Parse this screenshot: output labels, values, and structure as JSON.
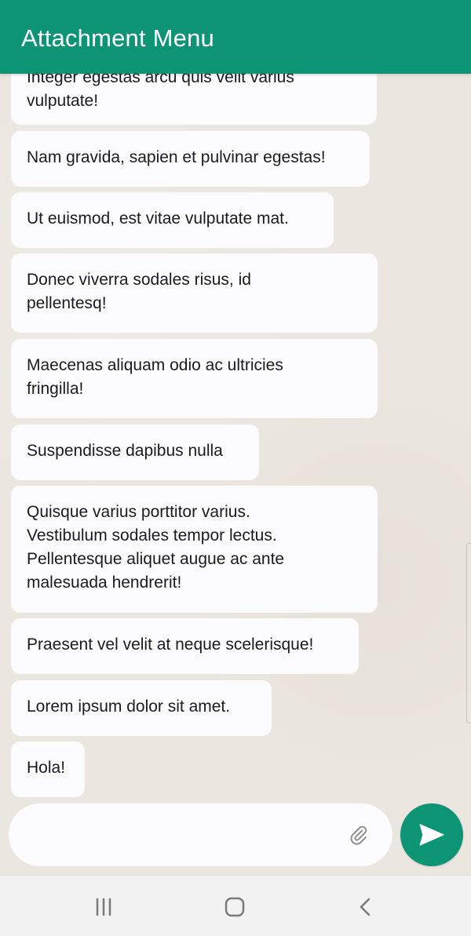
{
  "app": {
    "title": "Attachment Menu"
  },
  "messages": [
    {
      "text": "Integer egestas arcu quis velit varius\nvulputate!"
    },
    {
      "text": "Nam gravida, sapien et pulvinar egestas!"
    },
    {
      "text": "Ut euismod, est vitae vulputate mat."
    },
    {
      "text": "Donec viverra sodales risus, id\npellentesq!"
    },
    {
      "text": "Maecenas aliquam odio ac ultricies\nfringilla!"
    },
    {
      "text": "Suspendisse dapibus nulla"
    },
    {
      "text": "Quisque varius porttitor varius.\nVestibulum sodales tempor lectus.\nPellentesque aliquet augue ac ante\nmalesuada hendrerit!"
    },
    {
      "text": "Praesent vel velit at neque scelerisque!"
    },
    {
      "text": "Lorem ipsum dolor sit amet."
    },
    {
      "text": "Hola!"
    }
  ],
  "composer": {
    "value": "",
    "placeholder": ""
  },
  "icons": {
    "attach": "paperclip-icon",
    "send": "send-icon",
    "recent_apps": "recent-apps-icon",
    "home": "home-icon",
    "back": "back-icon"
  },
  "colors": {
    "primary": "#0d9475",
    "chat_background": "#ebe6df",
    "bubble": "#fcfbfd",
    "navigation_bar": "#f2f2f2"
  }
}
